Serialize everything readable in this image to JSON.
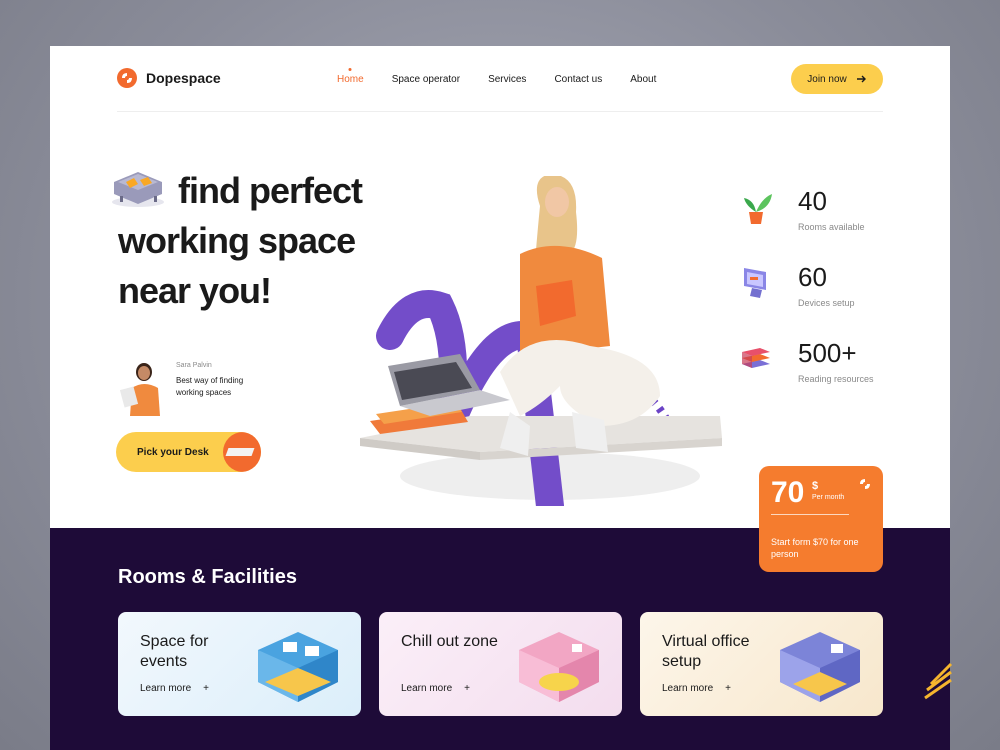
{
  "brand": {
    "name": "Dopespace",
    "accent": "#f26a2e",
    "yellow": "#fcce4d",
    "dark": "#1e0b38"
  },
  "nav": {
    "items": [
      {
        "label": "Home",
        "active": true
      },
      {
        "label": "Space operator"
      },
      {
        "label": "Services"
      },
      {
        "label": "Contact us"
      },
      {
        "label": "About"
      }
    ],
    "join_label": "Join now",
    "join_icon": "arrow-right-icon"
  },
  "hero": {
    "line1": "find perfect",
    "line2": "working space",
    "line3": "near you!",
    "testimonial": {
      "name": "Sara Palvin",
      "quote": "Best way of finding working spaces"
    },
    "cta_label": "Pick your Desk"
  },
  "stats": [
    {
      "value": "40",
      "label": "Rooms available",
      "icon": "plant-icon"
    },
    {
      "value": "60",
      "label": "Devices setup",
      "icon": "monitor-icon"
    },
    {
      "value": "500+",
      "label": "Reading resources",
      "icon": "books-icon"
    }
  ],
  "price": {
    "amount": "70",
    "currency": "$",
    "period": "Per month",
    "desc": "Start form $70 for one person"
  },
  "rooms": {
    "title": "Rooms & Facilities",
    "cards": [
      {
        "title": "Space for events",
        "link": "Learn more",
        "bg": "#e8f3fb"
      },
      {
        "title": "Chill out zone",
        "link": "Learn more",
        "bg": "#f7e6f3"
      },
      {
        "title": "Virtual office setup",
        "link": "Learn more",
        "bg": "#fbf2e4"
      }
    ]
  }
}
